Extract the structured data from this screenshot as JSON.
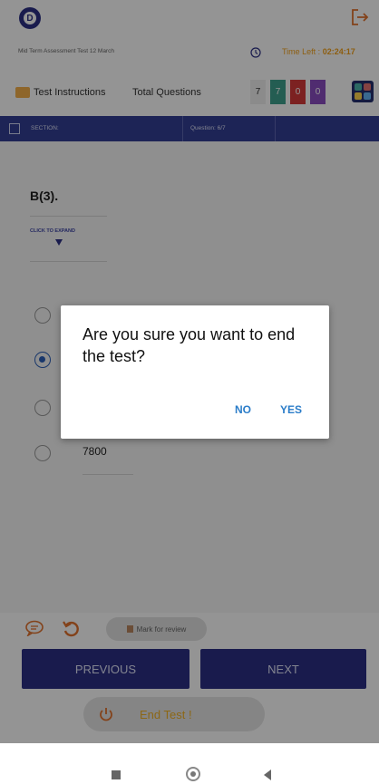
{
  "app": {
    "logo_letter": "D",
    "test_name": "Mid Term Assessment Test 12 March",
    "time_left_label": "Time Left :",
    "time_left_value": "02:24:17"
  },
  "summary": {
    "instructions_label": "Test Instructions",
    "total_questions_label": "Total Questions",
    "badges": [
      {
        "value": "7",
        "color": "#f0f0f0",
        "text_color": "#333333"
      },
      {
        "value": "7",
        "color": "#3fa18d",
        "text_color": "#ffffff"
      },
      {
        "value": "0",
        "color": "#d63a3a",
        "text_color": "#ffffff"
      },
      {
        "value": "0",
        "color": "#8a4cc1",
        "text_color": "#ffffff"
      }
    ]
  },
  "section_bar": {
    "section_label": "SECTION:",
    "question_label": "Question: 6/7"
  },
  "question": {
    "title": "B(3).",
    "expand_label": "CLICK TO EXPAND",
    "options": [
      {
        "text": "",
        "selected": false
      },
      {
        "text": "",
        "selected": true
      },
      {
        "text": "",
        "selected": false
      },
      {
        "text": "7800",
        "selected": false
      }
    ]
  },
  "dialog": {
    "message": "Are you sure you want to end the test?",
    "no_label": "NO",
    "yes_label": "YES"
  },
  "footer": {
    "mark_review_label": "Mark for review",
    "previous_label": "PREVIOUS",
    "next_label": "NEXT",
    "end_test_label": "End Test !"
  },
  "colors": {
    "primary": "#2b2f86",
    "accent": "#f3a21c",
    "dialog_action": "#2b7dc9"
  },
  "icons": [
    "exit-icon",
    "clock-icon",
    "instructions-icon",
    "palette-grid-icon",
    "section-icon",
    "comment-icon",
    "undo-icon",
    "flag-icon",
    "power-icon"
  ]
}
